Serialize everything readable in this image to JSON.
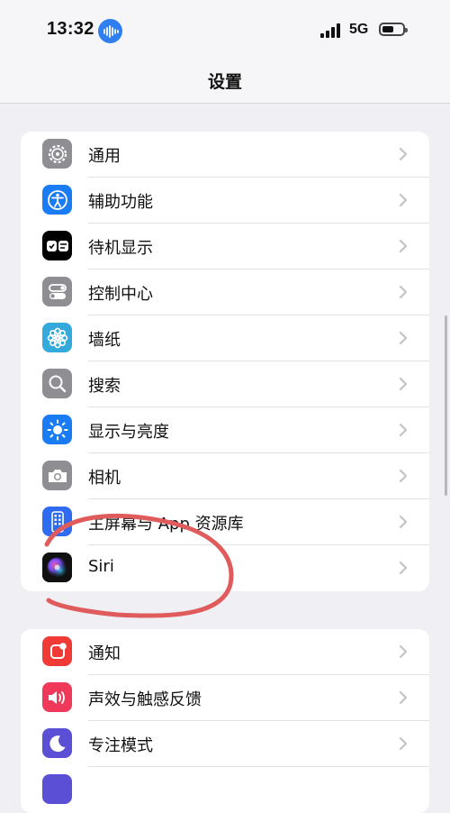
{
  "status_bar": {
    "time": "13:32",
    "network": "5G",
    "battery_level_percent": 55,
    "icons": [
      "siri-listening-icon",
      "cellular-signal-icon",
      "battery-icon"
    ]
  },
  "nav": {
    "title": "设置"
  },
  "groups": [
    {
      "items": [
        {
          "label": "通用",
          "icon": "gear-icon",
          "icon_bg": "#8e8e93"
        },
        {
          "label": "辅助功能",
          "icon": "accessibility-icon",
          "icon_bg": "#1a7cf5"
        },
        {
          "label": "待机显示",
          "icon": "standby-icon",
          "icon_bg": "#000000"
        },
        {
          "label": "控制中心",
          "icon": "switches-icon",
          "icon_bg": "#8e8e93"
        },
        {
          "label": "墙纸",
          "icon": "flower-icon",
          "icon_bg": "#34aadc"
        },
        {
          "label": "搜索",
          "icon": "magnifier-icon",
          "icon_bg": "#8e8e93"
        },
        {
          "label": "显示与亮度",
          "icon": "sun-icon",
          "icon_bg": "#1a7cf5"
        },
        {
          "label": "相机",
          "icon": "camera-icon",
          "icon_bg": "#8e8e93"
        },
        {
          "label": "主屏幕与 App 资源库",
          "icon": "home-screen-icon",
          "icon_bg": "#2f6bf0"
        },
        {
          "label": "Siri",
          "icon": "siri-icon",
          "icon_bg": "#111111"
        }
      ]
    },
    {
      "items": [
        {
          "label": "通知",
          "icon": "bell-icon",
          "icon_bg": "#f03a35"
        },
        {
          "label": "声效与触感反馈",
          "icon": "speaker-icon",
          "icon_bg": "#f0395a"
        },
        {
          "label": "专注模式",
          "icon": "moon-icon",
          "icon_bg": "#5b4fd6"
        },
        {
          "label": "",
          "icon": "hourglass-icon",
          "icon_bg": "#5b4fd6"
        }
      ]
    }
  ],
  "annotation": {
    "shape": "hand-drawn circle around Siri",
    "color": "#e05c5c"
  }
}
